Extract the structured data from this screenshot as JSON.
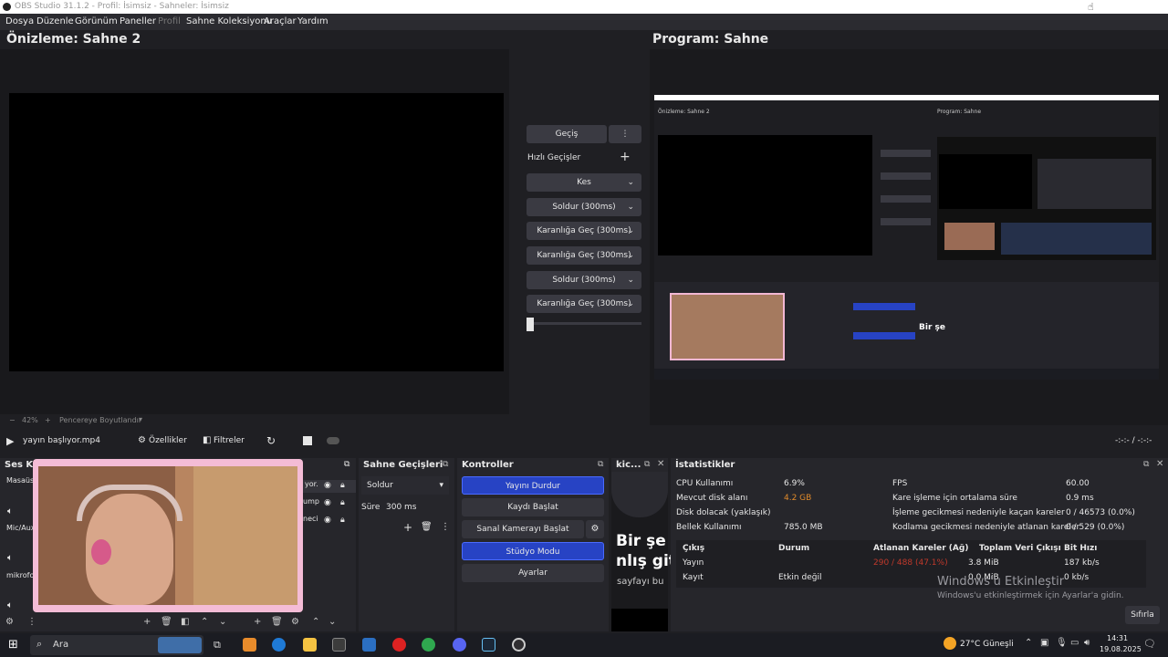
{
  "window": {
    "title": "OBS Studio 31.1.2 - Profil: İsimsiz - Sahneler: İsimsiz"
  },
  "menu": [
    "Dosya",
    "Düzenle",
    "Görünüm",
    "Paneller",
    "Profil",
    "Sahne Koleksiyonu",
    "Araçlar",
    "Yardım"
  ],
  "preview": {
    "title": "Önizleme: Sahne 2",
    "zoom": "42%",
    "fit_label": "Pencereye Boyutlandır"
  },
  "program": {
    "title": "Program: Sahne"
  },
  "transitions": {
    "transition_label": "Geçiş",
    "quick_label": "Hızlı Geçişler",
    "items": [
      "Kes",
      "Soldur (300ms)",
      "Karanlığa Geç (300ms)",
      "Karanlığa Geç (300ms)",
      "Soldur (300ms)",
      "Karanlığa Geç (300ms)"
    ]
  },
  "media": {
    "filename": "yayın başlıyor.mp4",
    "properties_label": "Özellikler",
    "filters_label": "Filtreler",
    "time": "-:-:- / -:-:-"
  },
  "audio": {
    "title": "Ses Karı",
    "tracks": [
      "Masaüstü",
      "Mic/Aux",
      "mikrofo"
    ]
  },
  "sources": {
    "items": [
      "yor.",
      "ump",
      "neci"
    ]
  },
  "scene_transitions": {
    "title": "Sahne Geçişleri",
    "selected": "Soldur",
    "duration_label": "Süre",
    "duration_value": "300 ms"
  },
  "controls": {
    "title": "Kontroller",
    "buttons": [
      "Yayını Durdur",
      "Kaydı Başlat",
      "Sanal Kamerayı Başlat",
      "Stüdyo Modu",
      "Ayarlar"
    ]
  },
  "chat": {
    "title": "kic...",
    "text1": "Bir şe",
    "text2": "nlış git",
    "text3": "sayfayı bu"
  },
  "stats": {
    "title": "İstatistikler",
    "rows_left": [
      {
        "label": "CPU Kullanımı",
        "value": "6.9%"
      },
      {
        "label": "Mevcut disk alanı",
        "value": "4.2 GB"
      },
      {
        "label": "Disk dolacak (yaklaşık)",
        "value": ""
      },
      {
        "label": "Bellek Kullanımı",
        "value": "785.0 MB"
      }
    ],
    "rows_right": [
      {
        "label": "FPS",
        "value": "60.00"
      },
      {
        "label": "Kare işleme için ortalama süre",
        "value": "0.9 ms"
      },
      {
        "label": "İşleme gecikmesi nedeniyle kaçan kareler",
        "value": "0 / 46573 (0.0%)"
      },
      {
        "label": "Kodlama gecikmesi nedeniyle atlanan kareler",
        "value": "0 / 529 (0.0%)"
      }
    ],
    "table_headers": [
      "Çıkış",
      "Durum",
      "Atlanan Kareler (Ağ)",
      "Toplam Veri Çıkışı",
      "Bit Hızı"
    ],
    "table_rows": [
      [
        "Yayın",
        "",
        "290 / 488 (47.1%)",
        "3.8 MiB",
        "187 kb/s"
      ],
      [
        "Kayıt",
        "Etkin değil",
        "",
        "0.0 MiB",
        "0 kb/s"
      ]
    ],
    "reset_label": "Sıfırla",
    "warning_color": "#c0392b",
    "orange_color": "#e08a2b"
  },
  "watermark": {
    "line1": "Windows'u Etkinleştir",
    "line2": "Windows'u etkinleştirmek için Ayarlar'a gidin."
  },
  "taskbar": {
    "search_placeholder": "Ara",
    "weather": "27°C Güneşli",
    "time": "14:31",
    "date": "19.08.2025"
  }
}
